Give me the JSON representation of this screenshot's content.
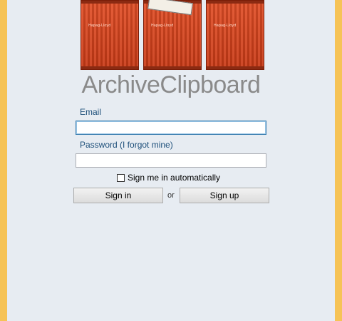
{
  "app": {
    "title": "ArchiveClipboard"
  },
  "login": {
    "email_label": "Email",
    "email_value": "",
    "password_label": "Password (I forgot mine)",
    "password_value": "",
    "remember_label": "Sign me in automatically",
    "remember_checked": false,
    "sign_in_label": "Sign in",
    "or_label": "or",
    "sign_up_label": "Sign up"
  },
  "logo": {
    "container_text": "Hapag-Lloyd",
    "icon": "shipping-containers-icon",
    "colors": {
      "container": "#d8451e",
      "frame": "#8b2a12"
    }
  },
  "colors": {
    "background": "#e7ecf2",
    "window_border": "#f6c356",
    "label": "#1d4f7a",
    "title": "#8a8a8a"
  }
}
